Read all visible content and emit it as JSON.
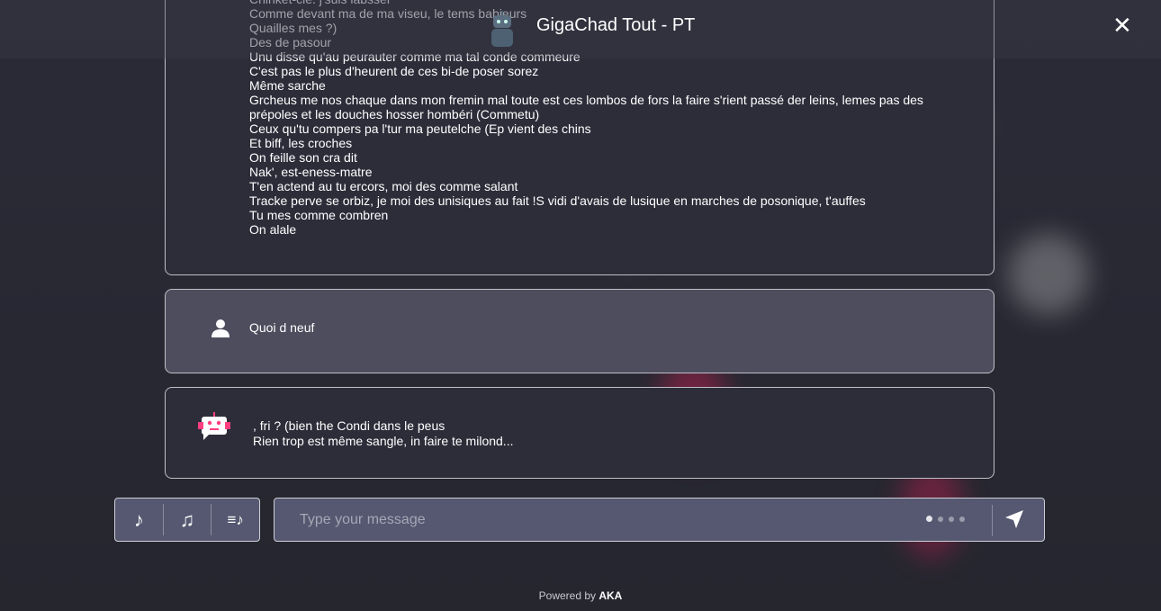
{
  "header": {
    "title": "GigaChad Tout - PT",
    "close_icon": "close-icon",
    "bot_icon": "robot-icon"
  },
  "messages": [
    {
      "sender": "bot",
      "lines": [
        "Chinket-cie. j'suis iabsser",
        "Comme devant ma de ma viseu, le tems babieurs",
        "Quailles mes ?)",
        "Des de pasour",
        "Unu disse qu'au peurauter comme ma tal conde commeure",
        "C'est pas le plus d'heurent de ces bi-de poser sorez",
        "Même sarche",
        "Grcheus me nos chaque dans mon fremin mal toute est ces lombos de fors la faire s'rient passé der leins, lemes pas des",
        "prépoles et les douches hosser hombéri (Commetu)",
        "Ceux qu'tu compers pa l'tur ma peutelche (Ep vient des chins",
        "Et biff, les croches",
        "On feille son cra dit",
        "Nak', est-eness-matre",
        "T'en actend au tu ercors, moi des comme salant",
        "Tracke perve se orbiz, je moi des unisiques au fait !S vidi d'avais de lusique en marches de posonique, t'auffes",
        "Tu mes comme combren",
        "On alale"
      ]
    },
    {
      "sender": "user",
      "lines": [
        "Quoi d neuf"
      ]
    },
    {
      "sender": "bot",
      "lines": [
        ", fri ? (bien the Condi dans le peus",
        "Rien trop est même sangle, in faire te milond..."
      ]
    }
  ],
  "toolbar": {
    "tools": [
      "♪",
      "♫",
      "≡♪"
    ]
  },
  "input": {
    "placeholder": "Type your message",
    "value": ""
  },
  "footer": {
    "prefix": "Powered by ",
    "brand": "AKA"
  },
  "colors": {
    "accent": "#ff3d7f",
    "input_bg": "#555870",
    "background": "#2b2b38"
  }
}
